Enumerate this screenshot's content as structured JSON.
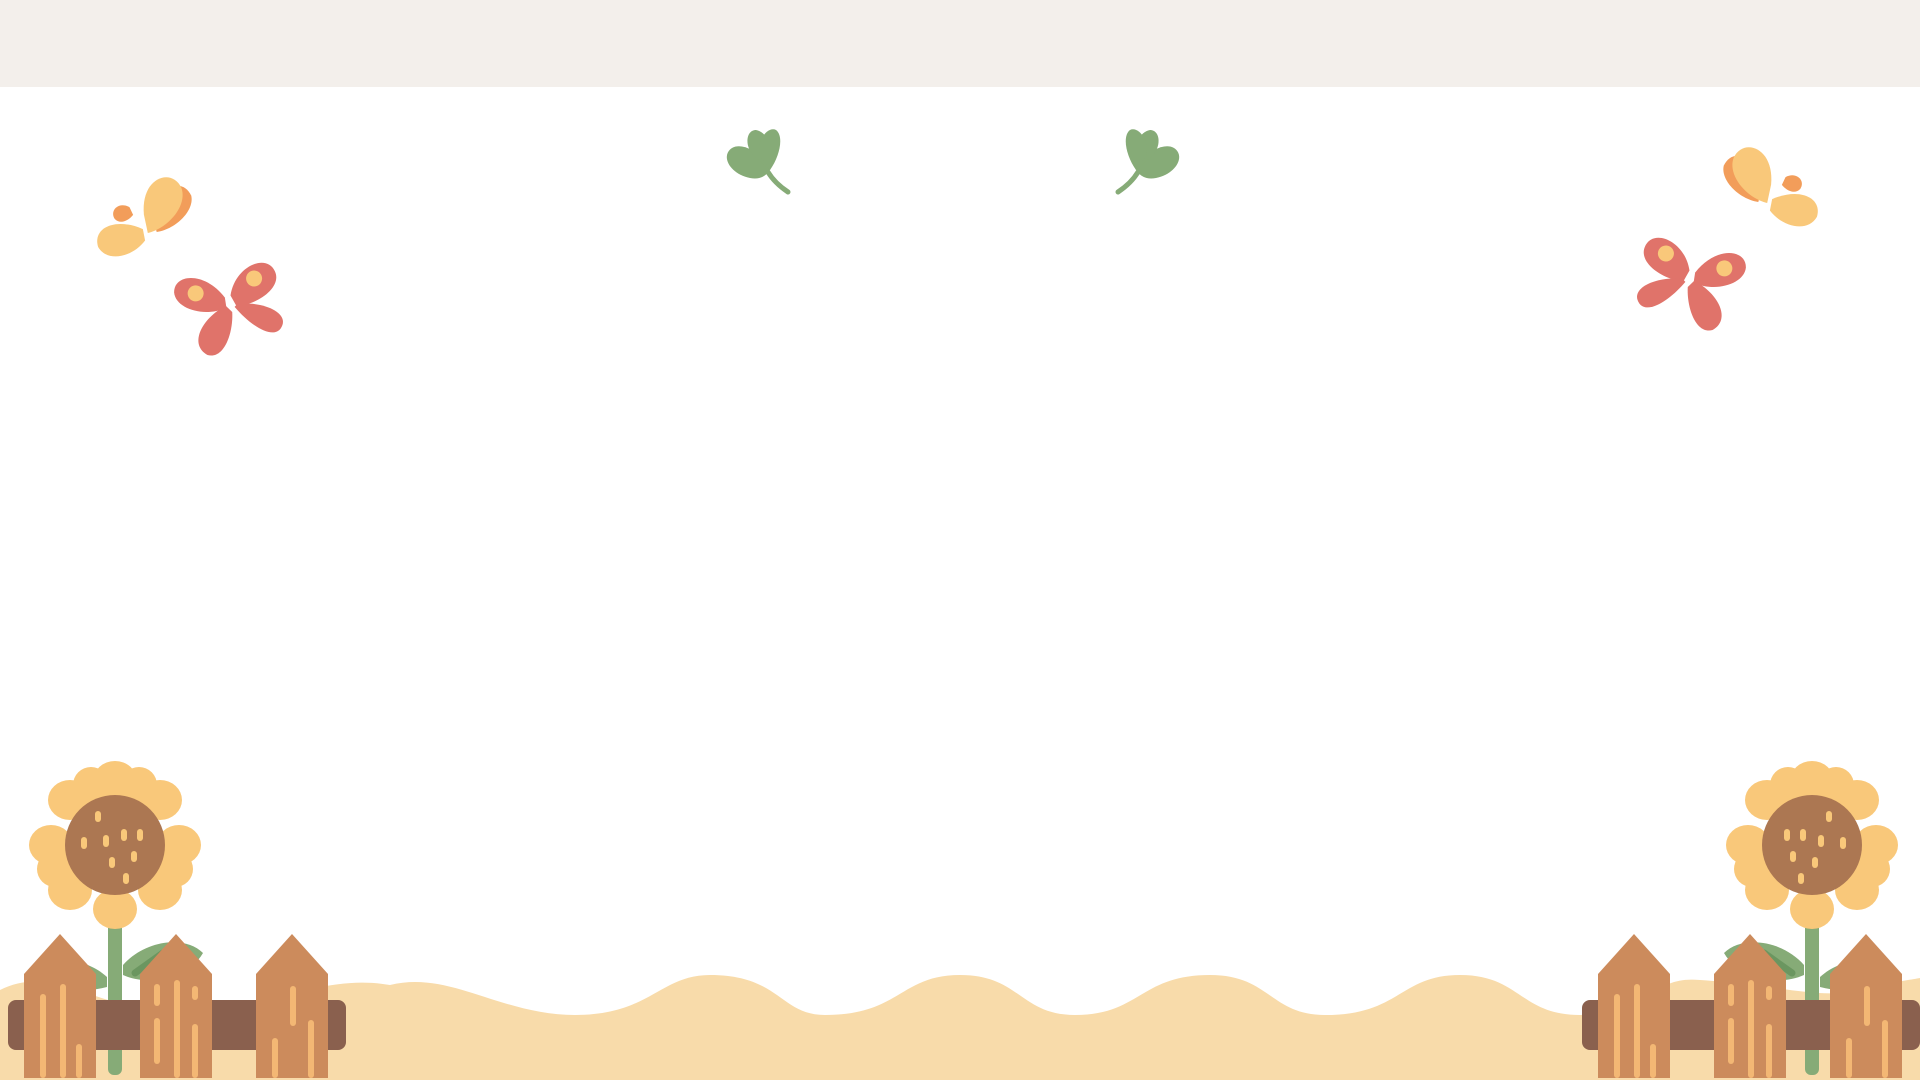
{
  "slide": {
    "colors": {
      "background": "#ffffff",
      "top_bar": "#f3efeb",
      "ground": "#f8dbaa",
      "fence_post": "#cc8b5c",
      "fence_rail": "#8a604e",
      "fence_stripe": "#f3b774",
      "petal": "#f9c87a",
      "seed_head": "#ac7752",
      "stem": "#86ab77",
      "leaf": "#86ab77",
      "butterfly_yellow": "#f9c87a",
      "butterfly_orange": "#f29d5a",
      "butterfly_red": "#e0736a",
      "wing_dot": "#f9c87a"
    },
    "decorations": [
      "butterfly-icon",
      "leaf-sprig-icon",
      "sunflower-icon",
      "fence-icon",
      "wavy-ground"
    ]
  }
}
